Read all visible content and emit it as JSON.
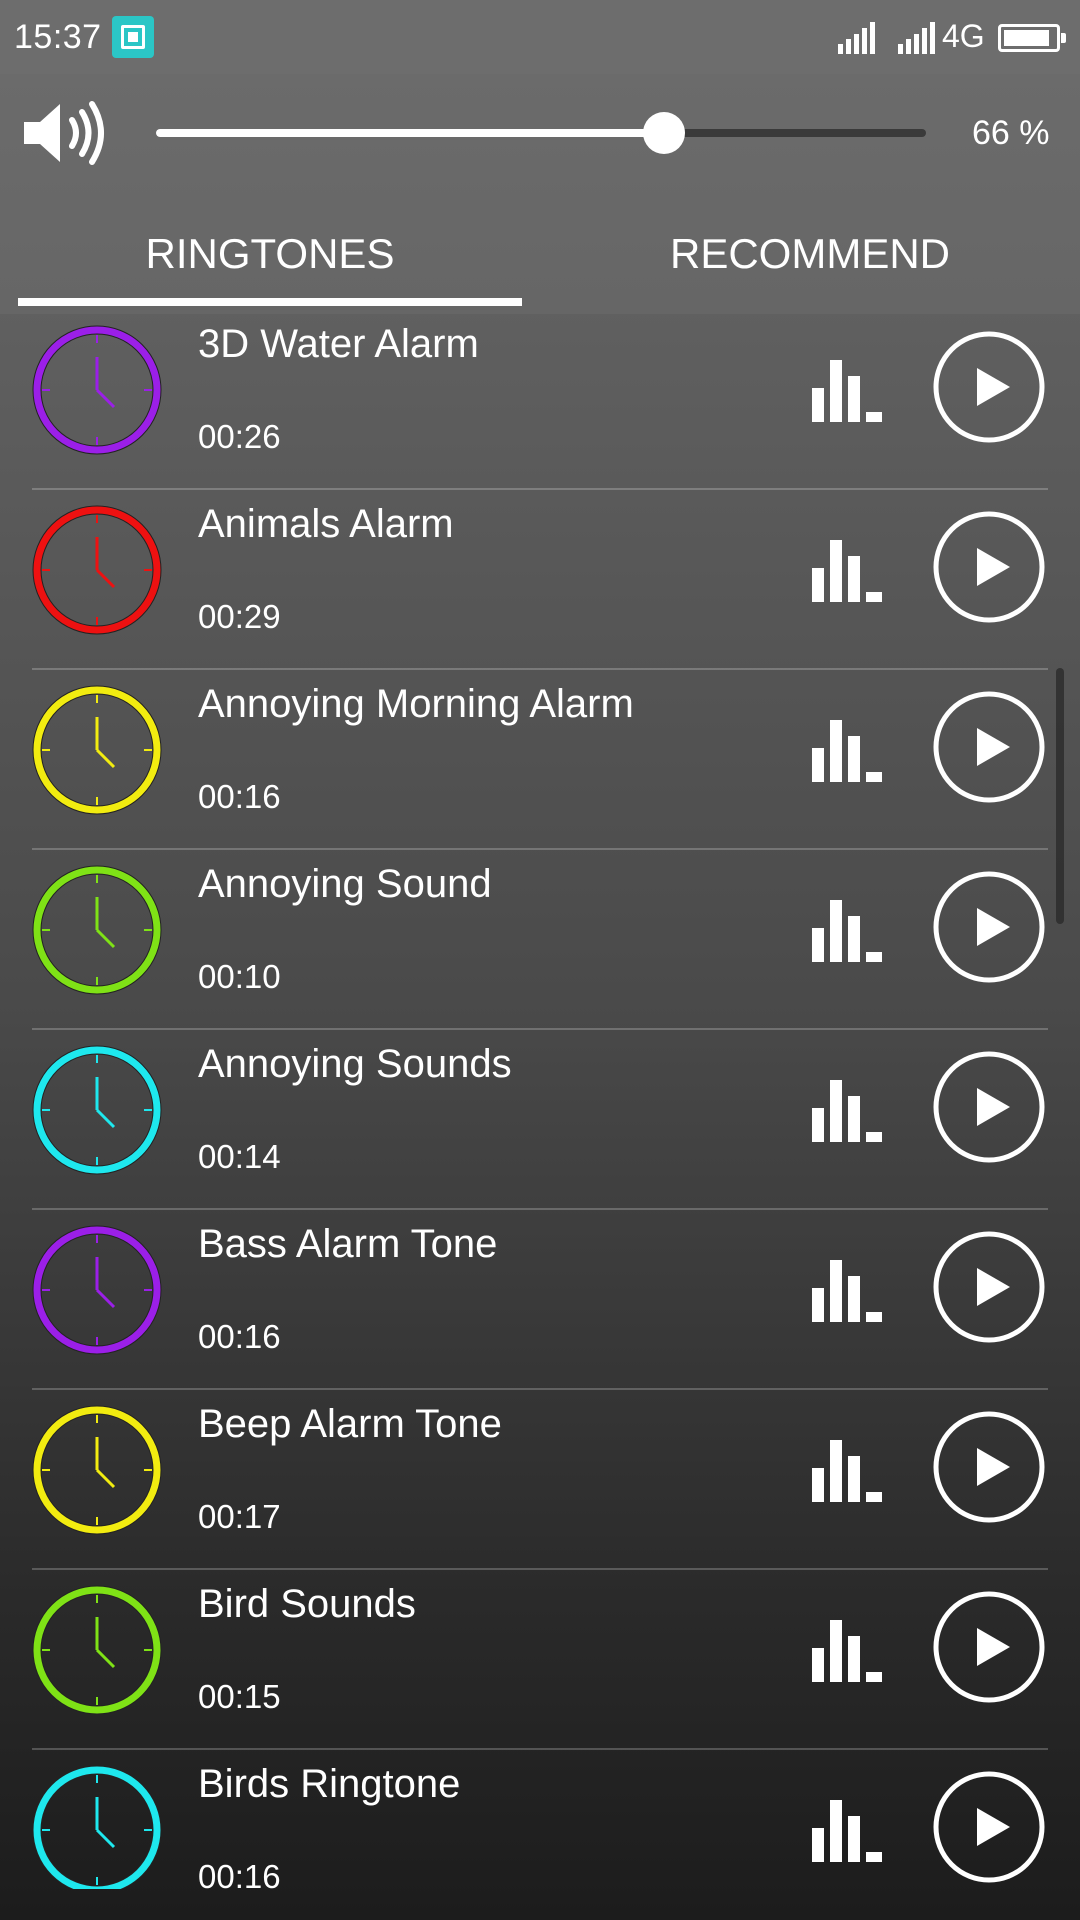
{
  "status_bar": {
    "time": "15:37",
    "network": "4G",
    "screenshot_icon": "screenshot-icon",
    "battery_level": 0.8
  },
  "volume": {
    "icon": "speaker-icon",
    "level": 66,
    "label": "66 %"
  },
  "tabs": [
    {
      "label": "RINGTONES",
      "active": true
    },
    {
      "label": "RECOMMEND",
      "active": false
    }
  ],
  "ringtones": [
    {
      "title": "3D Water Alarm",
      "duration": "00:26",
      "color": "#9b1fe8"
    },
    {
      "title": "Animals Alarm",
      "duration": "00:29",
      "color": "#ee1111"
    },
    {
      "title": "Annoying Morning Alarm",
      "duration": "00:16",
      "color": "#f2ec10"
    },
    {
      "title": "Annoying Sound",
      "duration": "00:10",
      "color": "#7fe216"
    },
    {
      "title": "Annoying Sounds",
      "duration": "00:14",
      "color": "#1ee8ee"
    },
    {
      "title": "Bass Alarm Tone",
      "duration": "00:16",
      "color": "#9b1fe8"
    },
    {
      "title": "Beep Alarm Tone",
      "duration": "00:17",
      "color": "#f2ec10"
    },
    {
      "title": "Bird Sounds",
      "duration": "00:15",
      "color": "#7fe216"
    },
    {
      "title": "Birds Ringtone",
      "duration": "00:16",
      "color": "#1ee8ee"
    }
  ],
  "colors": {
    "slider_fill": "#ffffff",
    "slider_track": "#3a3a3a",
    "status_bar": "#6d6d6d"
  }
}
